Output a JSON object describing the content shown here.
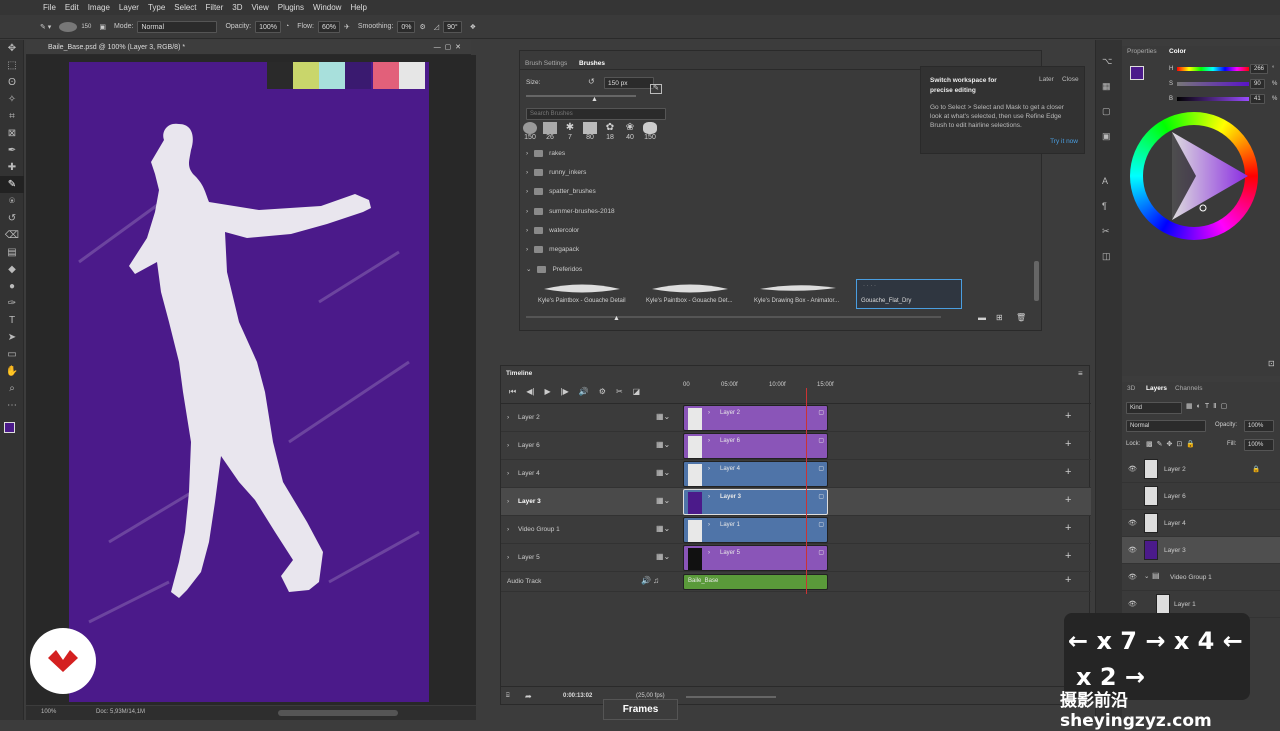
{
  "menu": [
    "File",
    "Edit",
    "Image",
    "Layer",
    "Type",
    "Select",
    "Filter",
    "3D",
    "View",
    "Plugins",
    "Window",
    "Help"
  ],
  "options": {
    "brush_size": "150",
    "mode_label": "Mode:",
    "mode_value": "Normal",
    "opacity_label": "Opacity:",
    "opacity_value": "100%",
    "flow_label": "Flow:",
    "flow_value": "60%",
    "smoothing_label": "Smoothing:",
    "smoothing_value": "0%",
    "angle_value": "90°"
  },
  "document": {
    "tab_title": "Baile_Base.psd @ 100% (Layer 3, RGB/8) *",
    "zoom": "100%",
    "doc_info": "Doc: 5,93M/14,1M",
    "swatches": [
      "#2a2a2a",
      "#c9d66b",
      "#a8e0dc",
      "#3a1a70",
      "#e2607a",
      "#e6e6e6"
    ],
    "canvas_color": "#4b1a8a"
  },
  "brush_panel": {
    "tab_settings": "Brush Settings",
    "tab_brushes": "Brushes",
    "size_label": "Size:",
    "size_value": "150 px",
    "search_placeholder": "Search Brushes",
    "presets": [
      "150",
      "26",
      "7",
      "80",
      "18",
      "40",
      "150"
    ],
    "folders": [
      "rakes",
      "runny_inkers",
      "spatter_brushes",
      "summer-brushes-2018",
      "watercolor",
      "megapack",
      "Preferidos"
    ],
    "strokes": [
      "Kyle's Paintbox - Gouache Detail",
      "Kyle's Paintbox - Gouache Det...",
      "Kyle's Drawing Box - Animator...",
      "Gouache_Flat_Dry"
    ]
  },
  "popup": {
    "title": "Switch workspace for precise editing",
    "later": "Later",
    "close": "Close",
    "body": "Go to Select > Select and Mask to get a closer look at what's selected, then use Refine Edge Brush to edit hairline selections.",
    "try": "Try it now"
  },
  "timeline": {
    "title": "Timeline",
    "ticks": [
      "00",
      "05:00f",
      "10:00f",
      "15:00f"
    ],
    "playhead_fraction": 0.85,
    "tracks": [
      {
        "name": "Layer 2",
        "clip": "Layer 2",
        "color": "#8a55b8"
      },
      {
        "name": "Layer 6",
        "clip": "Layer 6",
        "color": "#8a55b8"
      },
      {
        "name": "Layer 4",
        "clip": "Layer 4",
        "color": "#4f74a8"
      },
      {
        "name": "Layer 3",
        "clip": "Layer 3",
        "color": "#4f74a8"
      },
      {
        "name": "Video Group 1",
        "clip": "Layer 1",
        "color": "#4f74a8"
      },
      {
        "name": "Layer 5",
        "clip": "Layer 5",
        "color": "#8a55b8"
      }
    ],
    "audio_name": "Audio Track",
    "audio_clip": "Baile_Base",
    "audio_color": "#5a9a3a",
    "timecode": "0:00:13:02",
    "fps": "(25,00 fps)"
  },
  "color_panel": {
    "tab_properties": "Properties",
    "tab_color": "Color",
    "h_label": "H",
    "h_value": "266",
    "s_label": "S",
    "s_value": "90",
    "b_label": "B",
    "b_value": "41",
    "h_unit": "°",
    "s_unit": "%",
    "b_unit": "%",
    "current_color": "#4b1a8a"
  },
  "layers_panel": {
    "tab_3d": "3D",
    "tab_layers": "Layers",
    "tab_channels": "Channels",
    "kind": "Kind",
    "blend": "Normal",
    "opacity_label": "Opacity:",
    "opacity_value": "100%",
    "lock_label": "Lock:",
    "fill_label": "Fill:",
    "fill_value": "100%",
    "layers": [
      "Layer 2",
      "Layer 6",
      "Layer 4",
      "Layer 3",
      "Video Group 1",
      "Layer 1"
    ]
  },
  "overlay": {
    "line1": "← x 7 → x 4 ←",
    "line2": "x 2 →"
  },
  "frames_label": "Frames",
  "watermark": "摄影前沿 sheyingzyz.com"
}
